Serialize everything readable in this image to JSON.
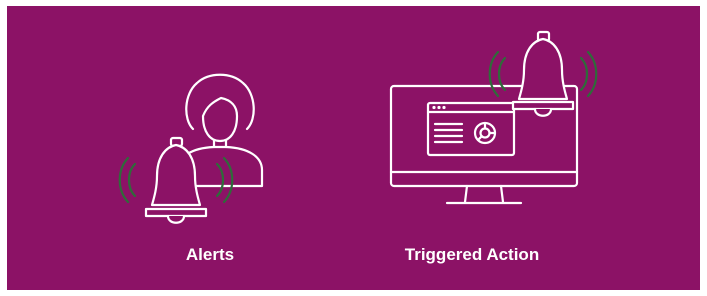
{
  "colors": {
    "background": "#8c1266",
    "line": "#ffffff",
    "sound_waves": "#2f6b3a"
  },
  "icons": [
    "person-icon",
    "bell-icon",
    "bell-icon",
    "monitor-icon",
    "browser-window-icon",
    "donut-chart-icon",
    "sound-wave-icon"
  ],
  "alerts": {
    "label": "Alerts"
  },
  "triggered_action": {
    "label": "Triggered Action"
  }
}
